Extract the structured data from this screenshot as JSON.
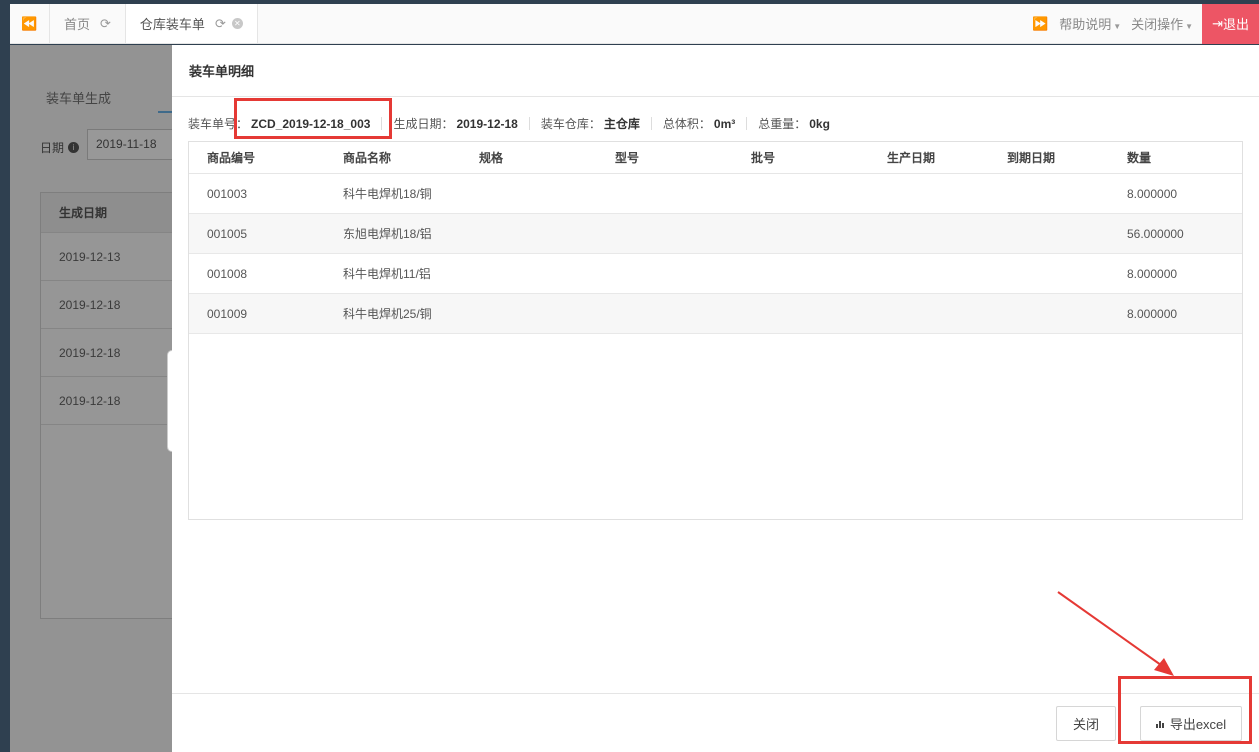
{
  "topbar": {
    "tabs": [
      {
        "label": "首页"
      },
      {
        "label": "仓库装车单"
      }
    ],
    "menus": [
      {
        "label": "帮助说明"
      },
      {
        "label": "关闭操作"
      }
    ],
    "logout_label": "退出"
  },
  "background": {
    "tab_label": "装车单生成",
    "date_label": "日期",
    "date_value": "2019-11-18",
    "table_header": "生成日期",
    "rows": [
      "2019-12-13",
      "2019-12-18",
      "2019-12-18",
      "2019-12-18"
    ]
  },
  "modal": {
    "title": "装车单明细",
    "info": {
      "order_no_label": "装车单号：",
      "order_no": "ZCD_2019-12-18_003",
      "date_label": "生成日期：",
      "date": "2019-12-18",
      "warehouse_label": "装车仓库：",
      "warehouse": "主仓库",
      "volume_label": "总体积：",
      "volume": "0m³",
      "weight_label": "总重量：",
      "weight": "0kg"
    },
    "columns": [
      "商品编号",
      "商品名称",
      "规格",
      "型号",
      "批号",
      "生产日期",
      "到期日期",
      "数量"
    ],
    "rows": [
      {
        "code": "001003",
        "name": "科牛电焊机18/铜",
        "qty": "8.000000"
      },
      {
        "code": "001005",
        "name": "东旭电焊机18/铝",
        "qty": "56.000000"
      },
      {
        "code": "001008",
        "name": "科牛电焊机11/铝",
        "qty": "8.000000"
      },
      {
        "code": "001009",
        "name": "科牛电焊机25/铜",
        "qty": "8.000000"
      }
    ],
    "close_label": "关闭",
    "export_label": "导出excel"
  },
  "colors": {
    "logout_bg": "#ed5565",
    "annotation_red": "#e53935",
    "sidebar_bg": "#2f4050"
  }
}
